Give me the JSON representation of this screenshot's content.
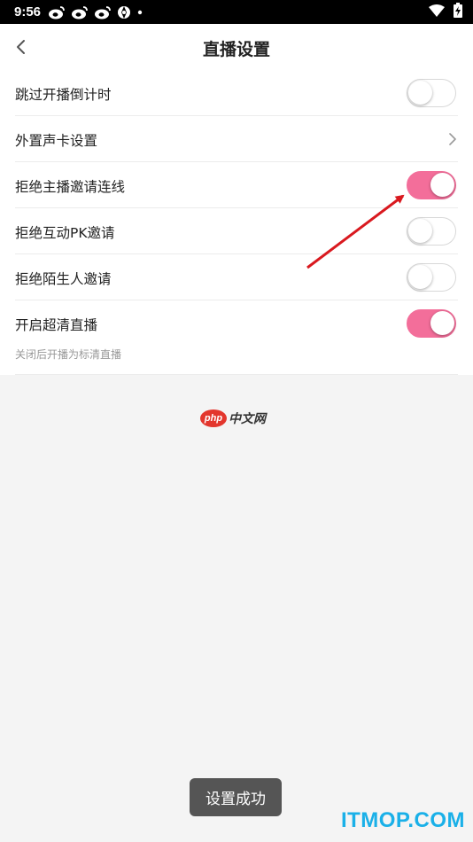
{
  "status_bar": {
    "time": "9:56",
    "icons_left": [
      "weibo-icon",
      "weibo-icon",
      "weibo-icon",
      "aperture-icon",
      "dot-icon"
    ],
    "icons_right": [
      "wifi-icon",
      "battery-icon"
    ]
  },
  "nav": {
    "back_icon": "chevron-left-icon",
    "title": "直播设置"
  },
  "settings": [
    {
      "label": "跳过开播倒计时",
      "type": "toggle",
      "on": false
    },
    {
      "label": "外置声卡设置",
      "type": "link"
    },
    {
      "label": "拒绝主播邀请连线",
      "type": "toggle",
      "on": true
    },
    {
      "label": "拒绝互动PK邀请",
      "type": "toggle",
      "on": false
    },
    {
      "label": "拒绝陌生人邀请",
      "type": "toggle",
      "on": false
    },
    {
      "label": "开启超清直播",
      "type": "toggle",
      "on": true
    }
  ],
  "hint": "关闭后开播为标清直播",
  "watermark": {
    "logo_text": "php",
    "text": "中文网"
  },
  "toast": "设置成功",
  "corner_mark": "ITMOP.COM",
  "colors": {
    "toggle_on": "#f36e9a",
    "toggle_off_border": "#d8d8d8",
    "annotation_arrow": "#d9191f",
    "corner_mark": "#1ab0e8"
  }
}
